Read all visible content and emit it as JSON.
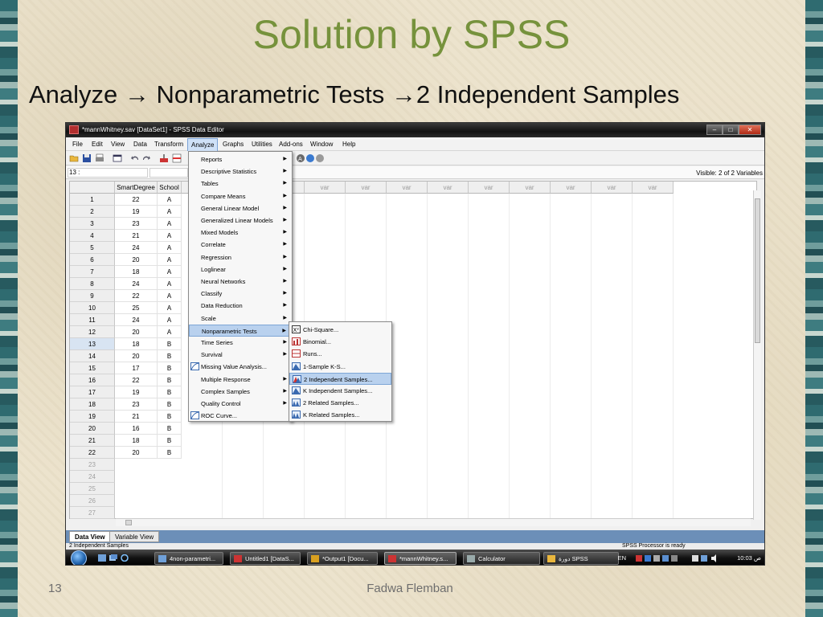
{
  "slide": {
    "title": "Solution by SPSS",
    "subtitle_parts": [
      "Analyze",
      "Nonparametric Tests",
      "2 Independent Samples"
    ],
    "arrow": "→",
    "slide_number": "13",
    "author": "Fadwa Flemban"
  },
  "window": {
    "title": "*mannWhitney.sav [DataSet1] - SPSS Data Editor",
    "controls": {
      "minimize": "–",
      "maximize": "□",
      "close": "✕"
    }
  },
  "menubar": [
    "File",
    "Edit",
    "View",
    "Data",
    "Transform",
    "Analyze",
    "Graphs",
    "Utilities",
    "Add-ons",
    "Window",
    "Help"
  ],
  "cellbar": {
    "cell_ref": "13 :",
    "visible": "Visible: 2 of 2 Variables"
  },
  "grid": {
    "columns": [
      "SmartDegree",
      "School"
    ],
    "var_label": "var",
    "rows": [
      [
        "22",
        "A"
      ],
      [
        "19",
        "A"
      ],
      [
        "23",
        "A"
      ],
      [
        "21",
        "A"
      ],
      [
        "24",
        "A"
      ],
      [
        "20",
        "A"
      ],
      [
        "18",
        "A"
      ],
      [
        "24",
        "A"
      ],
      [
        "22",
        "A"
      ],
      [
        "25",
        "A"
      ],
      [
        "24",
        "A"
      ],
      [
        "20",
        "A"
      ],
      [
        "18",
        "B"
      ],
      [
        "20",
        "B"
      ],
      [
        "17",
        "B"
      ],
      [
        "22",
        "B"
      ],
      [
        "19",
        "B"
      ],
      [
        "23",
        "B"
      ],
      [
        "21",
        "B"
      ],
      [
        "16",
        "B"
      ],
      [
        "18",
        "B"
      ],
      [
        "20",
        "B"
      ]
    ],
    "empty_rows": [
      "23",
      "24",
      "25",
      "26",
      "27"
    ]
  },
  "analyze_menu": [
    {
      "label": "Reports",
      "sub": true
    },
    {
      "label": "Descriptive Statistics",
      "sub": true
    },
    {
      "label": "Tables",
      "sub": true
    },
    {
      "label": "Compare Means",
      "sub": true
    },
    {
      "label": "General Linear Model",
      "sub": true
    },
    {
      "label": "Generalized Linear Models",
      "sub": true
    },
    {
      "label": "Mixed Models",
      "sub": true
    },
    {
      "label": "Correlate",
      "sub": true
    },
    {
      "label": "Regression",
      "sub": true
    },
    {
      "label": "Loglinear",
      "sub": true
    },
    {
      "label": "Neural Networks",
      "sub": true
    },
    {
      "label": "Classify",
      "sub": true
    },
    {
      "label": "Data Reduction",
      "sub": true
    },
    {
      "label": "Scale",
      "sub": true
    },
    {
      "label": "Nonparametric Tests",
      "sub": true,
      "highlight": true
    },
    {
      "label": "Time Series",
      "sub": true
    },
    {
      "label": "Survival",
      "sub": true
    },
    {
      "label": "Missing Value Analysis...",
      "sub": false,
      "icon": true
    },
    {
      "label": "Multiple Response",
      "sub": true
    },
    {
      "label": "Complex Samples",
      "sub": true
    },
    {
      "label": "Quality Control",
      "sub": true
    },
    {
      "label": "ROC Curve...",
      "sub": false,
      "icon": true
    }
  ],
  "nonparametric_submenu": [
    {
      "label": "Chi-Square...",
      "icon": "chi-square-icon"
    },
    {
      "label": "Binomial...",
      "icon": "binomial-icon"
    },
    {
      "label": "Runs...",
      "icon": "runs-icon"
    },
    {
      "label": "1-Sample K-S...",
      "icon": "ks-icon"
    },
    {
      "label": "2 Independent Samples...",
      "icon": "two-independent-icon",
      "highlight": true
    },
    {
      "label": "K Independent Samples...",
      "icon": "k-independent-icon"
    },
    {
      "label": "2 Related Samples...",
      "icon": "two-related-icon"
    },
    {
      "label": "K Related Samples...",
      "icon": "k-related-icon"
    }
  ],
  "tabs": [
    "Data View",
    "Variable View"
  ],
  "status": {
    "left": "2 Independent Samples",
    "right": "SPSS  Processor is ready"
  },
  "taskbar": {
    "buttons": [
      "4non-parametri...",
      "Untitled1 [DataS...",
      "*Output1 [Docu...",
      "*mannWhitney.s...",
      "Calculator",
      "دورة SPSS"
    ],
    "lang": "EN",
    "clock": "10:03 ص"
  },
  "colors": {
    "title": "#76923c",
    "menu_highlight": "#b9d1ee",
    "window_title": "#111111",
    "tabs_bar": "#6c8fb8"
  }
}
